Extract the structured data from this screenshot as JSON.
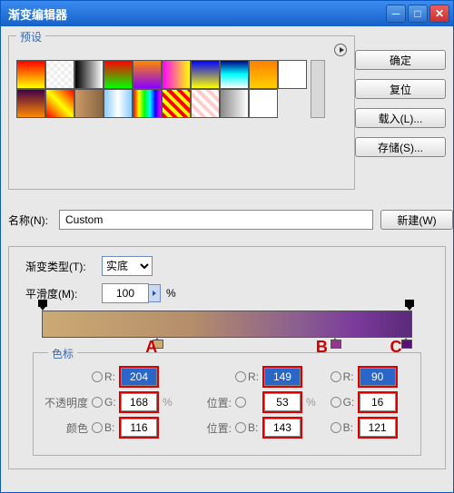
{
  "window": {
    "title": "渐变编辑器"
  },
  "buttons": {
    "ok": "确定",
    "reset": "复位",
    "load": "载入(L)...",
    "save": "存储(S)...",
    "new": "新建(W)"
  },
  "presets": {
    "legend": "预设"
  },
  "name": {
    "label": "名称(N):",
    "value": "Custom"
  },
  "gtype": {
    "type_label": "渐变类型(T):",
    "type_value": "实底",
    "smooth_label": "平滑度(M):",
    "smooth_value": "100",
    "pct": "%"
  },
  "ann": {
    "a": "A",
    "b": "B",
    "c": "C"
  },
  "stops": {
    "legend": "色标",
    "labels": {
      "opacity": "不透明度",
      "pos": "位置:",
      "color": "颜色",
      "r": "R:",
      "g": "G:",
      "b": "B:"
    },
    "a": {
      "r": "204",
      "g": "168",
      "b": "116"
    },
    "b": {
      "r": "149",
      "g": "53",
      "b": "143"
    },
    "c": {
      "r": "90",
      "g": "16",
      "b": "121"
    }
  },
  "chart_data": {
    "type": "gradient",
    "stops": [
      {
        "label": "A",
        "position_pct": 30,
        "rgb": [
          204,
          168,
          116
        ]
      },
      {
        "label": "B",
        "position_pct": 78,
        "rgb": [
          149,
          53,
          143
        ]
      },
      {
        "label": "C",
        "position_pct": 97,
        "rgb": [
          90,
          16,
          121
        ]
      }
    ]
  }
}
